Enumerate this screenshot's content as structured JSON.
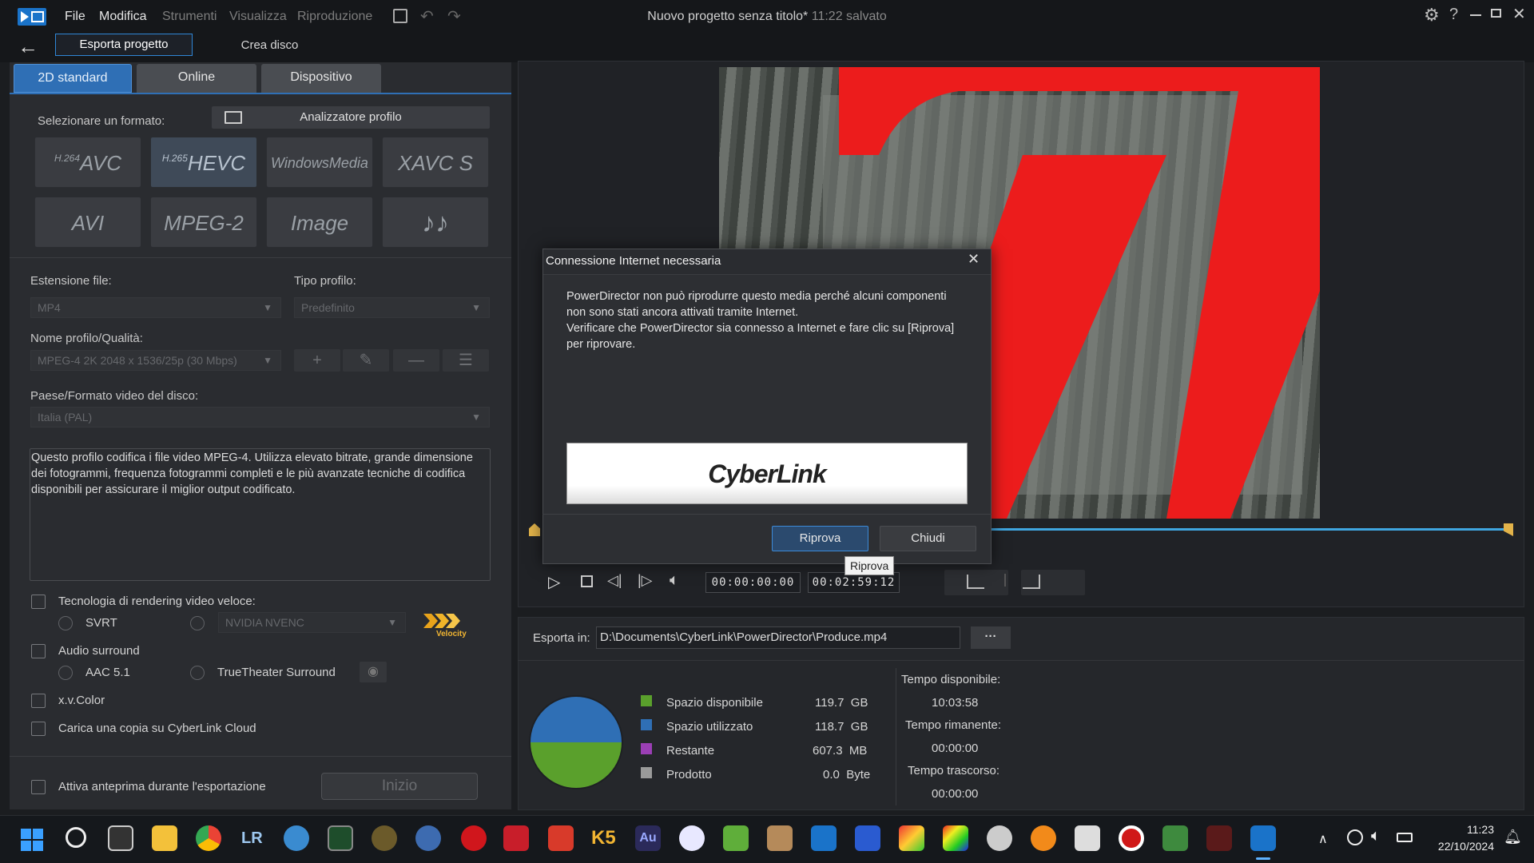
{
  "app": {
    "title": "Nuovo progetto senza titolo*",
    "saved": "11:22 salvato",
    "menu": [
      "File",
      "Modifica",
      "Strumenti",
      "Visualizza",
      "Riproduzione"
    ]
  },
  "nav": {
    "tab_export": "Esporta progetto",
    "tab_disc": "Crea disco"
  },
  "format_tabs": [
    "2D standard",
    "Online",
    "Dispositivo"
  ],
  "format": {
    "select_label": "Selezionare un formato:",
    "profile_analyzer": "Analizzatore profilo",
    "buttons": [
      {
        "sup": "H.264",
        "label": "AVC"
      },
      {
        "sup": "H.265",
        "label": "HEVC"
      },
      {
        "sup": "",
        "label": "WindowsMedia"
      },
      {
        "sup": "",
        "label": "XAVC S"
      },
      {
        "sup": "",
        "label": "AVI"
      },
      {
        "sup": "",
        "label": "MPEG-2"
      },
      {
        "sup": "",
        "label": "Image"
      },
      {
        "sup": "",
        "label": "♪♪"
      }
    ]
  },
  "settings": {
    "ext_label": "Estensione file:",
    "ext_value": "MP4",
    "profile_type_label": "Tipo profilo:",
    "profile_type_value": "Predefinito",
    "profile_name_label": "Nome profilo/Qualità:",
    "profile_name_value": "MPEG-4 2K 2048 x 1536/25p (30 Mbps)",
    "country_label": "Paese/Formato video del disco:",
    "country_value": "Italia (PAL)",
    "description": "Questo profilo codifica i file video MPEG-4. Utilizza elevato bitrate, grande dimensione dei fotogrammi, frequenza fotogrammi completi e le più avanzate tecniche di codifica disponibili per assicurare il miglior output codificato."
  },
  "options": {
    "fast_render": "Tecnologia di rendering video veloce:",
    "svrt": "SVRT",
    "nvenc": "NVIDIA NVENC",
    "velocity": "Velocity",
    "surround": "Audio surround",
    "aac": "AAC 5.1",
    "truetheater": "TrueTheater Surround",
    "xvcolor": "x.v.Color",
    "cloud": "Carica una copia su CyberLink Cloud",
    "preview": "Attiva anteprima durante l'esportazione",
    "start": "Inizio"
  },
  "player": {
    "time_current": "00:00:00:00",
    "time_total": "00:02:59:12"
  },
  "export": {
    "label": "Esporta in:",
    "path": "D:\\Documents\\CyberLink\\PowerDirector\\Produce.mp4",
    "browse": "···",
    "legend": [
      {
        "label": "Spazio disponibile",
        "value": "119.7",
        "unit": "GB",
        "color": "#5aa02c"
      },
      {
        "label": "Spazio utilizzato",
        "value": "118.7",
        "unit": "GB",
        "color": "#2f6fb5"
      },
      {
        "label": "Restante",
        "value": "607.3",
        "unit": "MB",
        "color": "#9b3fb5"
      },
      {
        "label": "Prodotto",
        "value": "0.0",
        "unit": "Byte",
        "color": "#9a9a9a"
      }
    ],
    "time_available_label": "Tempo disponibile:",
    "time_available": "10:03:58",
    "time_remaining_label": "Tempo rimanente:",
    "time_remaining": "00:00:00",
    "time_elapsed_label": "Tempo trascorso:",
    "time_elapsed": "00:00:00"
  },
  "dialog": {
    "title": "Connessione Internet necessaria",
    "line1": "PowerDirector non può riprodurre questo media perché alcuni componenti",
    "line2": "non sono stati ancora attivati tramite Internet.",
    "line3": "Verificare che PowerDirector sia connesso a Internet e fare clic su [Riprova]",
    "line4": "per riprovare.",
    "brand": "CyberLink",
    "retry": "Riprova",
    "close": "Chiudi",
    "tooltip": "Riprova"
  },
  "taskbar": {
    "time": "11:23",
    "date": "22/10/2024"
  }
}
